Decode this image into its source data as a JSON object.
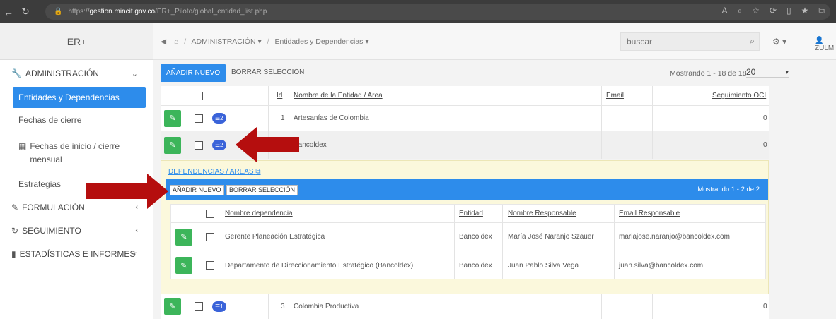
{
  "browser": {
    "url_prefix": "https://",
    "url_host": "gestion.mincit.gov.co",
    "url_path": "/ER+_Piloto/global_entidad_list.php"
  },
  "app": {
    "brand": "ER+"
  },
  "breadcrumb": {
    "section": "ADMINISTRACIÓN",
    "page": "Entidades y Dependencias"
  },
  "search": {
    "placeholder": "buscar"
  },
  "user": {
    "name": "ZULM"
  },
  "sidebar": {
    "sections": [
      {
        "label": "ADMINISTRACIÓN",
        "icon": "wrench-icon"
      },
      {
        "label": "FORMULACIÓN",
        "icon": "edit-icon"
      },
      {
        "label": "SEGUIMIENTO",
        "icon": "refresh-icon"
      },
      {
        "label": "ESTADÍSTICAS E INFORMES",
        "icon": "bar-chart-icon"
      }
    ],
    "items": [
      {
        "label": "Entidades y Dependencias",
        "active": true
      },
      {
        "label": "Fechas de cierre"
      },
      {
        "label": "Fechas de inicio / cierre mensual"
      },
      {
        "label": "Estrategias"
      }
    ]
  },
  "toolbar": {
    "add_label": "AÑADIR NUEVO",
    "delete_label": "BORRAR SELECCIÓN",
    "showing": "Mostrando 1 - 18 de 18",
    "page_size": "20"
  },
  "grid": {
    "columns": [
      "Id",
      "Nombre de la Entidad / Area",
      "Email",
      "Seguimiento OCI"
    ],
    "rows": [
      {
        "id": "1",
        "name": "Artesanías de Colombia",
        "email": "",
        "oci": "0",
        "badge": "2"
      },
      {
        "id": "2",
        "name": "Bancoldex",
        "email": "",
        "oci": "0",
        "badge": "2"
      },
      {
        "id": "3",
        "name": "Colombia Productiva",
        "email": "",
        "oci": "0",
        "badge": "1"
      }
    ]
  },
  "detail": {
    "link": "DEPENDENCIAS / AREAS",
    "add_label": "AÑADIR NUEVO",
    "delete_label": "BORRAR SELECCIÓN",
    "showing": "Mostrando 1 - 2 de 2",
    "columns": [
      "Nombre dependencia",
      "Entidad",
      "Nombre Responsable",
      "Email Responsable"
    ],
    "rows": [
      {
        "name": "Gerente Planeación Estratégica",
        "entity": "Bancoldex",
        "responsible": "María José Naranjo Szauer",
        "email": "mariajose.naranjo@bancoldex.com"
      },
      {
        "name": "Departamento de Direccionamiento Estratégico (Bancoldex)",
        "entity": "Bancoldex",
        "responsible": "Juan Pablo Silva Vega",
        "email": "juan.silva@bancoldex.com"
      }
    ]
  },
  "colors": {
    "accent": "#2d8ceb",
    "edit": "#3cb55a",
    "badge": "#3a63d9",
    "arrow": "#b50e0e",
    "detail_bg": "#fbf8dc"
  }
}
